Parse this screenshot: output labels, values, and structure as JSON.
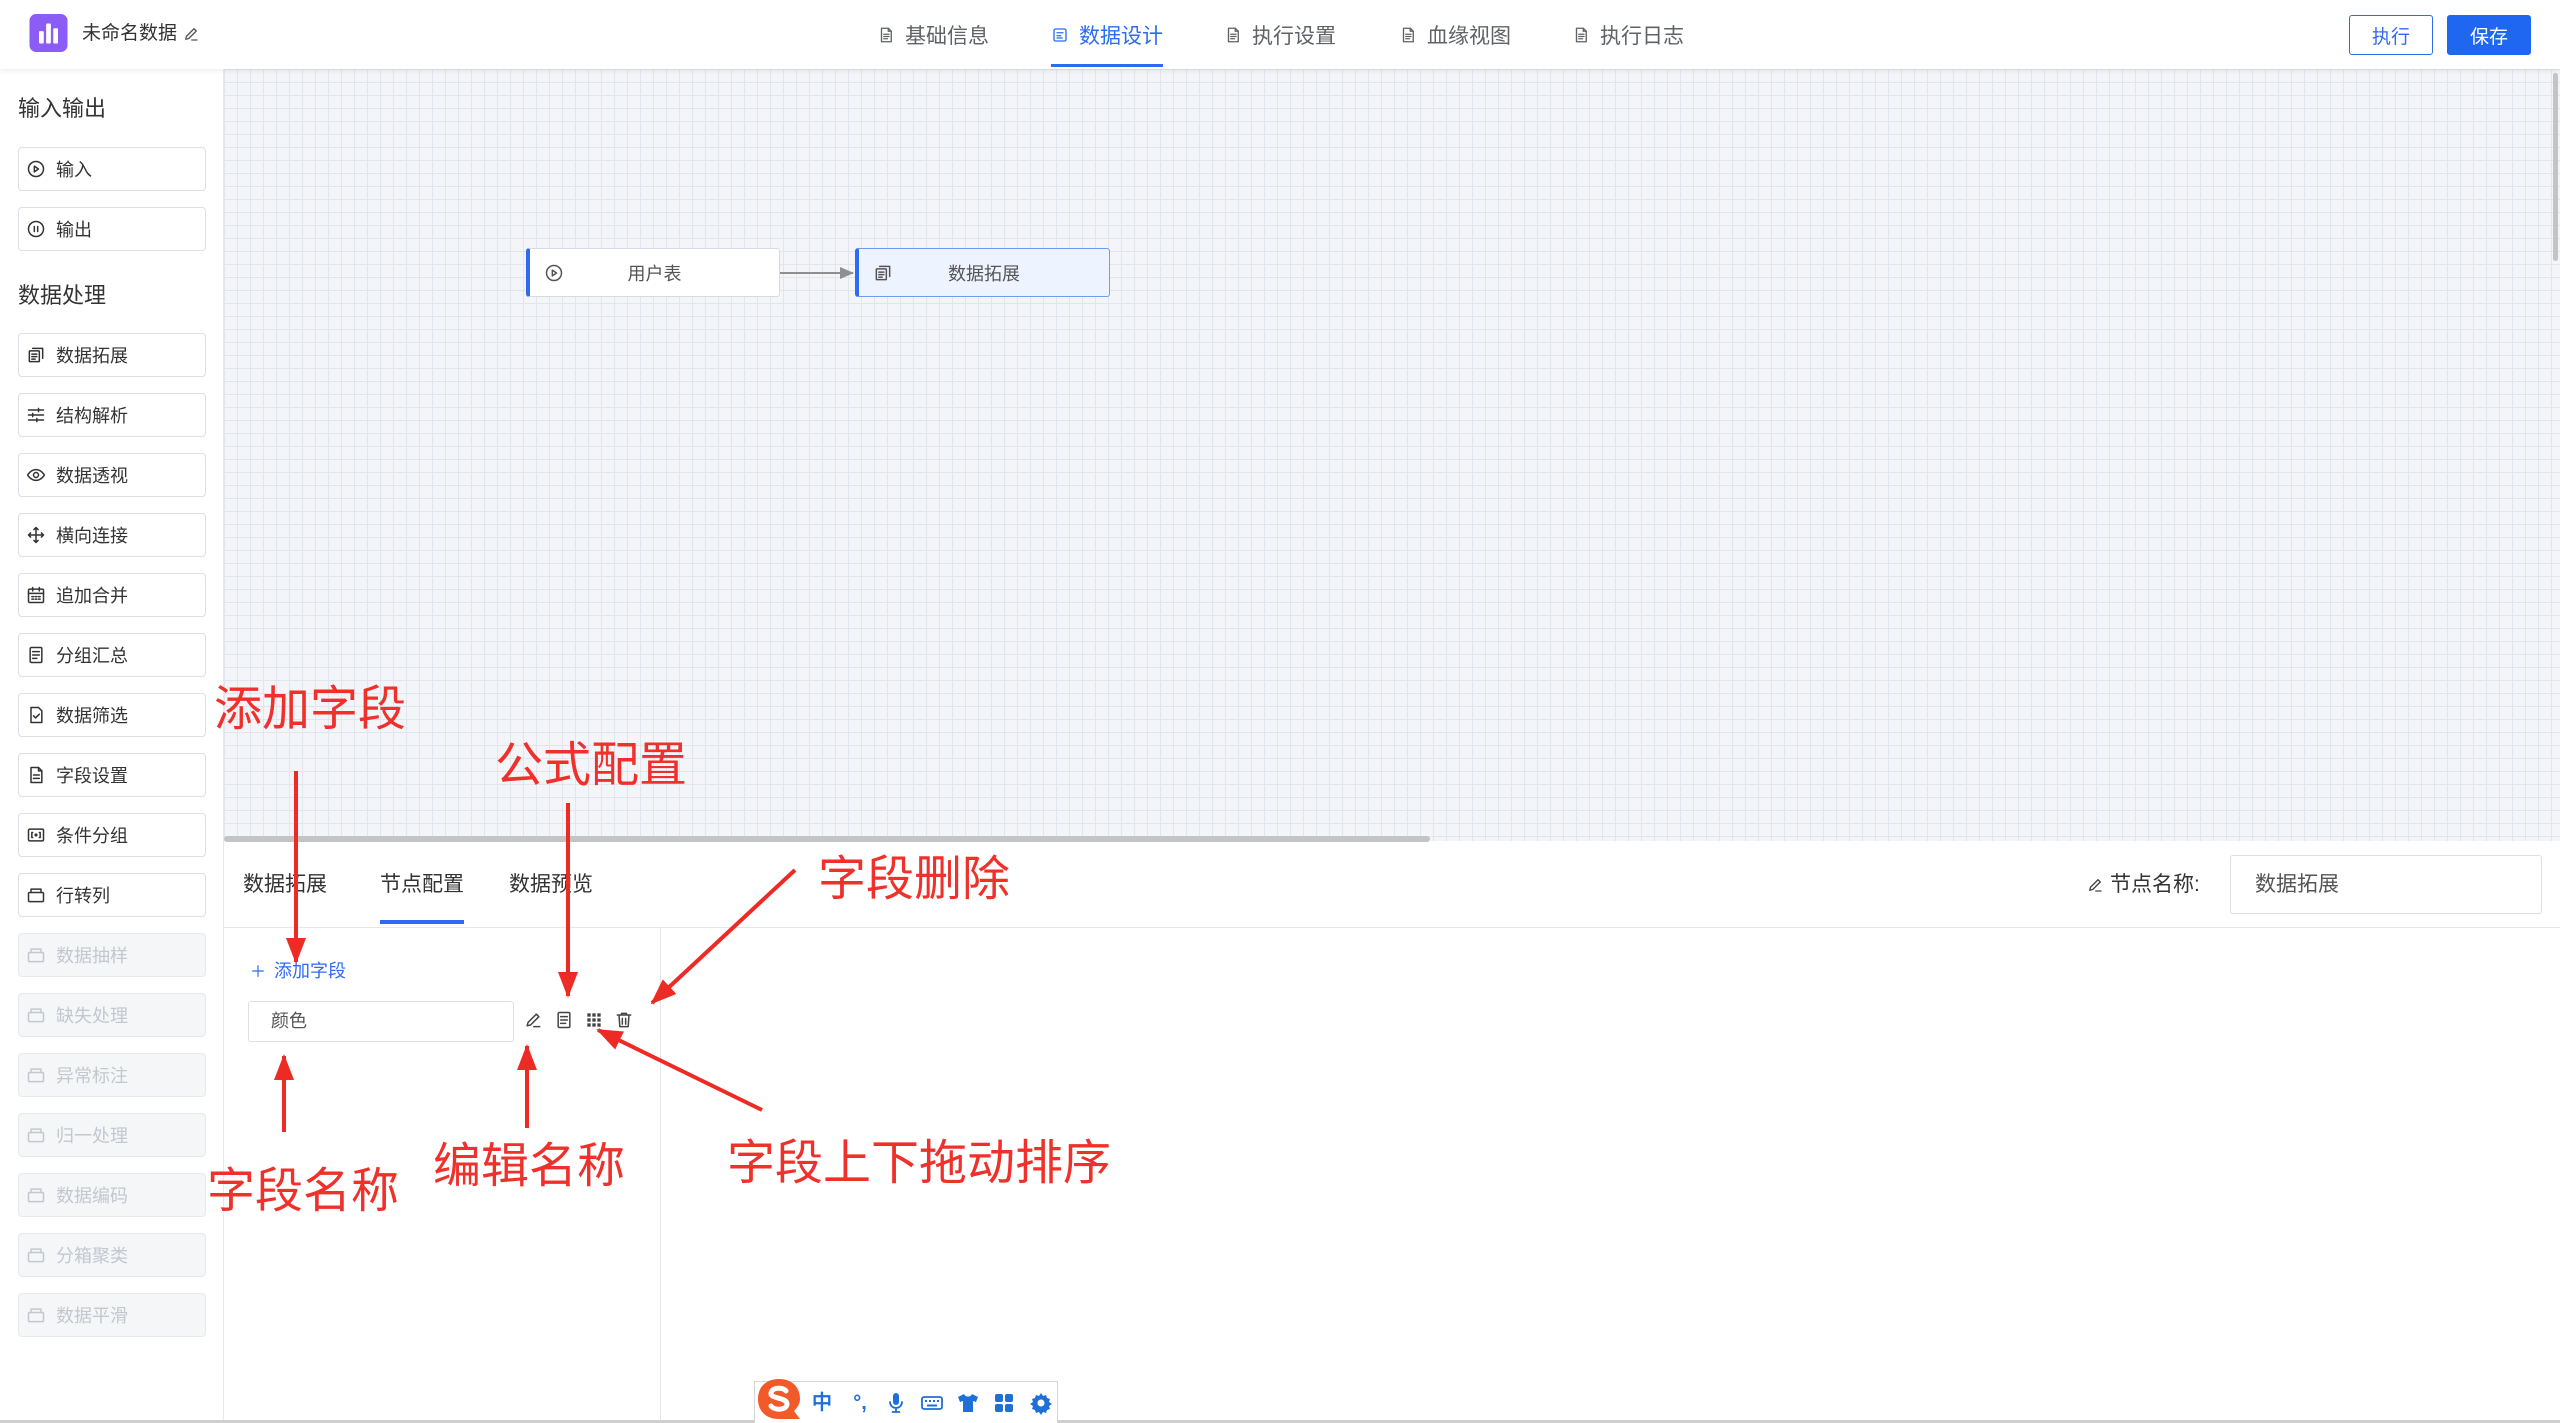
{
  "app": {
    "title": "未命名数据"
  },
  "header": {
    "tabs": [
      {
        "label": "基础信息",
        "icon": "document-icon"
      },
      {
        "label": "数据设计",
        "icon": "layout-icon",
        "active": true
      },
      {
        "label": "执行设置",
        "icon": "document-icon"
      },
      {
        "label": "血缘视图",
        "icon": "document-icon"
      },
      {
        "label": "执行日志",
        "icon": "document-icon"
      }
    ],
    "run_button": "执行",
    "save_button": "保存"
  },
  "sidebar": {
    "sections": [
      {
        "title": "输入输出",
        "items": [
          {
            "label": "输入",
            "icon": "play-circle-icon"
          },
          {
            "label": "输出",
            "icon": "pause-circle-icon"
          }
        ]
      },
      {
        "title": "数据处理",
        "items": [
          {
            "label": "数据拓展",
            "icon": "copy-doc-icon"
          },
          {
            "label": "结构解析",
            "icon": "sliders-icon"
          },
          {
            "label": "数据透视",
            "icon": "eye-icon"
          },
          {
            "label": "横向连接",
            "icon": "move-icon"
          },
          {
            "label": "追加合并",
            "icon": "calendar-icon"
          },
          {
            "label": "分组汇总",
            "icon": "doc-list-icon"
          },
          {
            "label": "数据筛选",
            "icon": "doc-check-icon"
          },
          {
            "label": "字段设置",
            "icon": "doc-icon"
          },
          {
            "label": "条件分组",
            "icon": "bracket-box-icon"
          },
          {
            "label": "行转列",
            "icon": "tray-icon"
          },
          {
            "label": "数据抽样",
            "icon": "tray-icon",
            "disabled": true
          },
          {
            "label": "缺失处理",
            "icon": "tray-icon",
            "disabled": true
          },
          {
            "label": "异常标注",
            "icon": "tray-icon",
            "disabled": true
          },
          {
            "label": "归一处理",
            "icon": "tray-icon",
            "disabled": true
          },
          {
            "label": "数据编码",
            "icon": "tray-icon",
            "disabled": true
          },
          {
            "label": "分箱聚类",
            "icon": "tray-icon",
            "disabled": true
          },
          {
            "label": "数据平滑",
            "icon": "tray-icon",
            "disabled": true
          }
        ]
      }
    ]
  },
  "canvas": {
    "nodes": [
      {
        "label": "用户表",
        "icon": "play-circle-icon"
      },
      {
        "label": "数据拓展",
        "icon": "copy-doc-icon",
        "selected": true
      }
    ]
  },
  "panel": {
    "tabs": [
      {
        "label": "数据拓展"
      },
      {
        "label": "节点配置",
        "active": true
      },
      {
        "label": "数据预览"
      }
    ],
    "node_name": {
      "label": "节点名称:",
      "value": "数据拓展"
    },
    "add_field": "添加字段",
    "fields": [
      {
        "name": "颜色",
        "actions": [
          "edit-icon",
          "formula-icon",
          "drag-grid-icon",
          "trash-icon"
        ]
      }
    ]
  },
  "annotations": [
    {
      "text": "添加字段"
    },
    {
      "text": "公式配置"
    },
    {
      "text": "字段删除"
    },
    {
      "text": "字段名称"
    },
    {
      "text": "编辑名称"
    },
    {
      "text": "字段上下拖动排序"
    }
  ],
  "ime": {
    "lang": "中",
    "punct": "°,",
    "icons": [
      "mic-icon",
      "keyboard-icon",
      "shirt-icon",
      "apps-icon",
      "gear-icon"
    ]
  },
  "colors": {
    "primary": "#2f6bf2",
    "logo": "#8b5cf6",
    "annotation": "#f0302a",
    "disabled_text": "#c3c7cf",
    "ime_blue": "#1f6fd8",
    "ime_logo": "#f25a2a"
  }
}
